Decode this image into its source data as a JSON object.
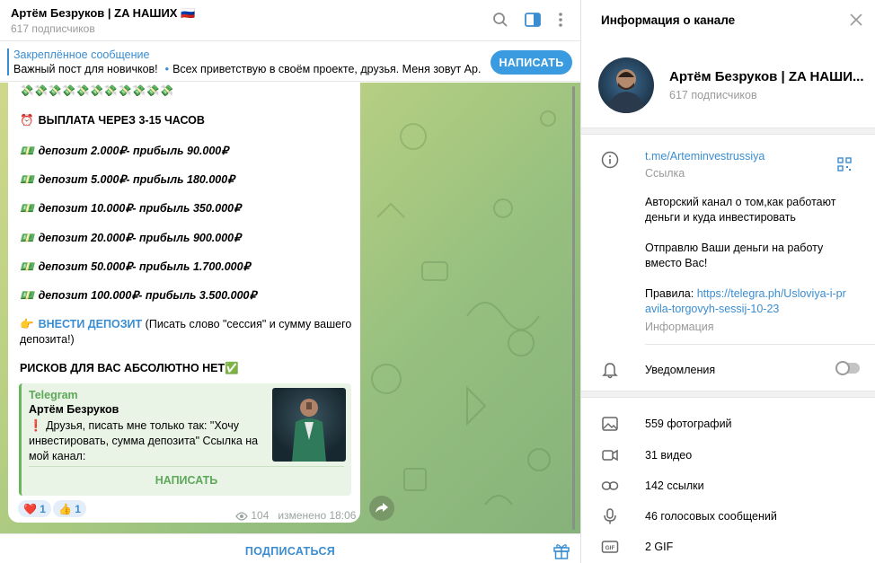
{
  "header": {
    "title": "Артём Безруков | ZA НАШИХ 🇷🇺",
    "subtitle": "617 подписчиков"
  },
  "pinned": {
    "title": "Закреплённое сообщение",
    "text_1": "Важный пост для новичков!",
    "text_2": "Всех приветствую в своём проекте, друзья. Меня зовут Ар...",
    "button": "НАПИСАТЬ"
  },
  "message": {
    "emoji_row": "💸💸💸💸💸💸💸💸💸💸💸",
    "payout": "ВЫПЛАТА ЧЕРЕЗ 3-15 ЧАСОВ",
    "deposits": [
      "депозит 2.000₽- прибыль 90.000₽",
      "депозит 5.000₽- прибыль 180.000₽",
      "депозит 10.000₽- прибыль 350.000₽",
      "депозит 20.000₽- прибыль 900.000₽",
      "депозит 50.000₽- прибыль 1.700.000₽",
      "депозит 100.000₽- прибыль 3.500.000₽"
    ],
    "deposit_link": "ВНЕСТИ ДЕПОЗИТ",
    "deposit_note_1": "(Писать слово \"сессия\" и сумму вашего",
    "deposit_note_2": "депозита!)",
    "risk": "РИСКОВ ДЛЯ ВАС АБСОЛЮТНО НЕТ",
    "forward": {
      "source": "Telegram",
      "name": "Артём Безруков",
      "text": "Друзья, писать мне только так: \"Хочу инвестировать, сумма депозита\" Ссылка на мой канал:",
      "button": "НАПИСАТЬ"
    },
    "reactions": [
      {
        "emoji": "❤️",
        "count": "1"
      },
      {
        "emoji": "👍",
        "count": "1"
      }
    ],
    "views": "104",
    "edited": "изменено 18:06"
  },
  "bottom": {
    "subscribe": "ПОДПИСАТЬСЯ"
  },
  "info": {
    "title": "Информация о канале",
    "name": "Артём Безруков | ZA НАШИ...",
    "subscribers": "617 подписчиков",
    "link": "t.me/Arteminvestrussiya",
    "link_label": "Ссылка",
    "desc_1": "Авторский канал о том,как работают деньги и куда инвестировать",
    "desc_2": "Отправлю Ваши деньги на работу вместо Вас!",
    "rules_label": "Правила: ",
    "rules_link": "https://telegra.ph/Usloviya-i-pravila-torgovyh-sessij-10-23",
    "info_label": "Информация",
    "notifications": "Уведомления",
    "media": [
      {
        "icon": "photo-icon",
        "label": "559 фотографий"
      },
      {
        "icon": "video-icon",
        "label": "31 видео"
      },
      {
        "icon": "link-icon",
        "label": "142 ссылки"
      },
      {
        "icon": "mic-icon",
        "label": "46 голосовых сообщений"
      },
      {
        "icon": "gif-icon",
        "label": "2 GIF"
      }
    ]
  },
  "colors": {
    "accent": "#3a8dd1",
    "button": "#3a9be0",
    "forward_accent": "#5ea85a"
  }
}
